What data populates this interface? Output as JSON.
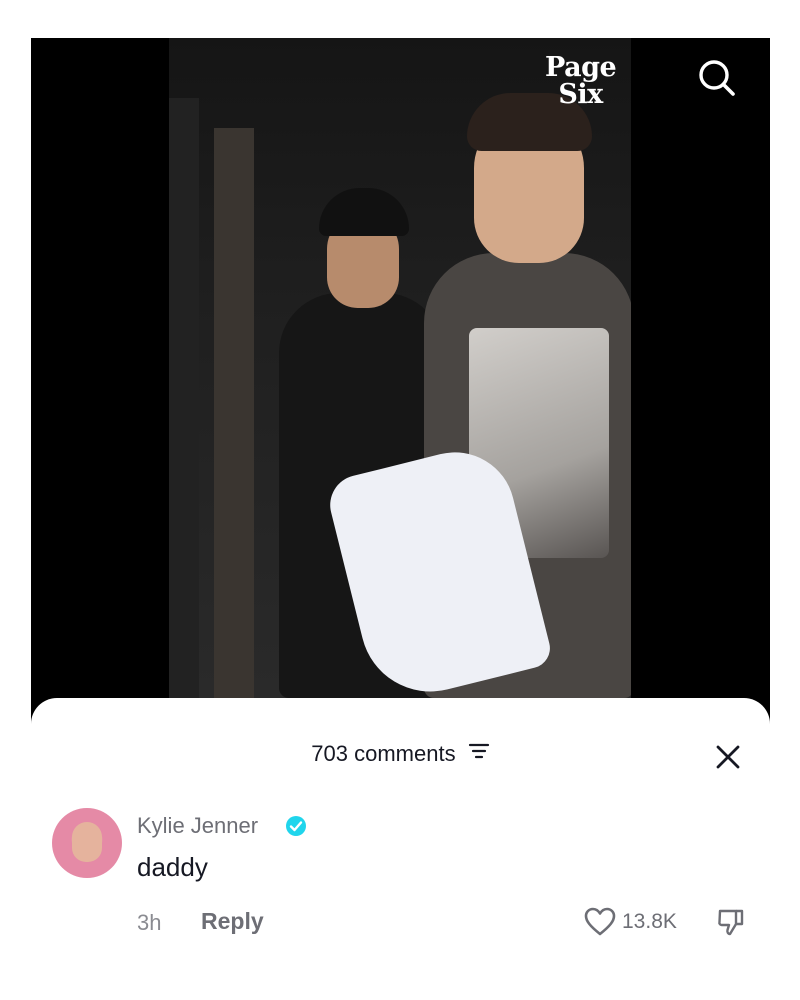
{
  "video": {
    "brand_line1": "Page",
    "brand_line2": "Six"
  },
  "icons": {
    "search": "search-icon",
    "filter": "filter-icon",
    "close": "close-icon",
    "verified": "verified-badge-icon",
    "like": "heart-icon",
    "dislike": "thumbs-down-icon"
  },
  "comments_sheet": {
    "count_label": "703 comments",
    "comments": [
      {
        "username": "Kylie Jenner",
        "verified": true,
        "text": "daddy",
        "time": "3h",
        "reply_label": "Reply",
        "likes": "13.8K"
      }
    ]
  },
  "colors": {
    "verified_blue": "#20d5ec",
    "primary_text": "#161823",
    "secondary_text": "#6d6e75"
  }
}
